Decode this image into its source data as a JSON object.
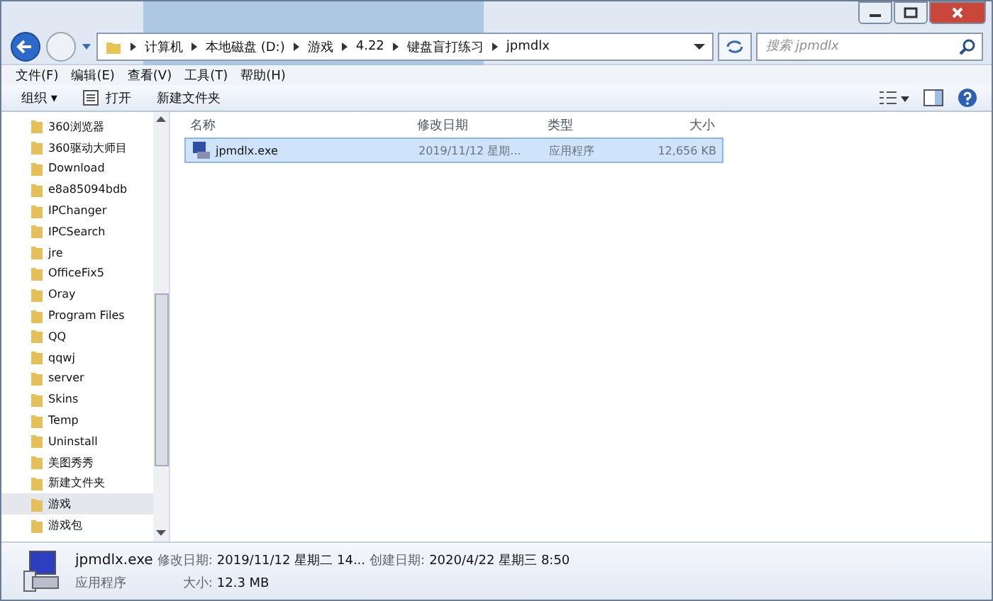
{
  "address_bar": {
    "segments": [
      "计算机",
      "本地磁盘 (D:)",
      "游戏",
      "4.22",
      "键盘盲打练习",
      "jpmdlx"
    ]
  },
  "search": {
    "placeholder": "搜索 jpmdlx"
  },
  "menu": [
    "文件(F)",
    "编辑(E)",
    "查看(V)",
    "工具(T)",
    "帮助(H)"
  ],
  "toolbar": {
    "organize": "组织 ▾",
    "open": "打开",
    "new_folder": "新建文件夹"
  },
  "sidebar": {
    "items": [
      {
        "label": "360浏览器",
        "selected": false
      },
      {
        "label": "360驱动大师目",
        "selected": false
      },
      {
        "label": "Download",
        "selected": false
      },
      {
        "label": "e8a85094bdb",
        "selected": false
      },
      {
        "label": "IPChanger",
        "selected": false
      },
      {
        "label": "IPCSearch",
        "selected": false
      },
      {
        "label": "jre",
        "selected": false
      },
      {
        "label": "OfficeFix5",
        "selected": false
      },
      {
        "label": "Oray",
        "selected": false
      },
      {
        "label": "Program Files",
        "selected": false
      },
      {
        "label": "QQ",
        "selected": false
      },
      {
        "label": "qqwj",
        "selected": false
      },
      {
        "label": "server",
        "selected": false
      },
      {
        "label": "Skins",
        "selected": false
      },
      {
        "label": "Temp",
        "selected": false
      },
      {
        "label": "Uninstall",
        "selected": false
      },
      {
        "label": "美图秀秀",
        "selected": false
      },
      {
        "label": "新建文件夹",
        "selected": false
      },
      {
        "label": "游戏",
        "selected": true
      },
      {
        "label": "游戏包",
        "selected": false
      }
    ]
  },
  "table": {
    "columns": [
      "名称",
      "修改日期",
      "类型",
      "大小"
    ],
    "rows": [
      {
        "name": "jpmdlx.exe",
        "modified": "2019/11/12 星期...",
        "type": "应用程序",
        "size": "12,656 KB",
        "selected": true
      }
    ]
  },
  "details": {
    "name": "jpmdlx.exe",
    "modified_label": "修改日期:",
    "modified": "2019/11/12 星期二 14...",
    "created_label": "创建日期:",
    "created": "2020/4/22 星期三 8:50",
    "type": "应用程序",
    "size_label": "大小:",
    "size": "12.3 MB"
  }
}
